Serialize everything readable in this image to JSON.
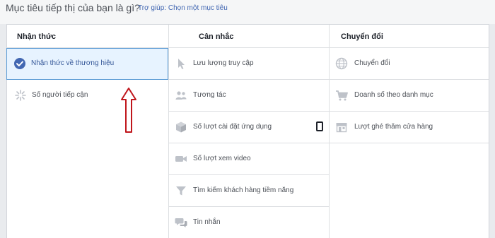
{
  "header": {
    "title": "Mục tiêu tiếp thị của bạn là gì?",
    "help": "Trợ giúp: Chọn một mục tiêu"
  },
  "columns": [
    {
      "title": "Nhận thức",
      "items": [
        {
          "label": "Nhận thức về thương hiệu",
          "icon": "checkmark-circle-icon",
          "selected": true
        },
        {
          "label": "Số người tiếp cận",
          "icon": "reach-burst-icon",
          "selected": false
        }
      ]
    },
    {
      "title": "Cân nhắc",
      "items": [
        {
          "label": "Lưu lượng truy cập",
          "icon": "cursor-icon"
        },
        {
          "label": "Tương tác",
          "icon": "people-icon"
        },
        {
          "label": "Số lượt cài đặt ứng dụng",
          "icon": "box-icon"
        },
        {
          "label": "Số lượt xem video",
          "icon": "video-camera-icon"
        },
        {
          "label": "Tìm kiếm khách hàng tiềm năng",
          "icon": "funnel-icon"
        },
        {
          "label": "Tin nhắn",
          "icon": "chat-bubbles-icon"
        }
      ]
    },
    {
      "title": "Chuyển đổi",
      "items": [
        {
          "label": "Chuyển đổi",
          "icon": "globe-icon"
        },
        {
          "label": "Doanh số theo danh mục",
          "icon": "shopping-cart-icon"
        },
        {
          "label": "Lượt ghé thăm cửa hàng",
          "icon": "store-icon"
        }
      ]
    }
  ],
  "colors": {
    "accent": "#4267b2",
    "selected_bg": "#e7f3ff",
    "selected_border": "#5b9bd5",
    "icon_gray": "#bec2c9",
    "annotation_arrow": "#c0161c"
  }
}
